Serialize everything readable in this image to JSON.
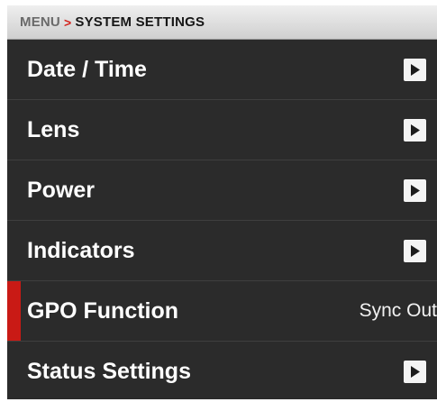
{
  "breadcrumb": {
    "menu": "MENU",
    "separator": ">",
    "current": "SYSTEM SETTINGS"
  },
  "menu_items": [
    {
      "label": "Date / Time",
      "has_submenu": true
    },
    {
      "label": "Lens",
      "has_submenu": true
    },
    {
      "label": "Power",
      "has_submenu": true
    },
    {
      "label": "Indicators",
      "has_submenu": true
    },
    {
      "label": "GPO Function",
      "value": "Sync Out",
      "selected": true
    },
    {
      "label": "Status Settings",
      "has_submenu": true
    }
  ],
  "colors": {
    "accent": "#c91a15",
    "panel": "#2b2b2b",
    "header": "#dcdcdc"
  },
  "icons": {
    "submenu": "chevron-right-icon"
  }
}
